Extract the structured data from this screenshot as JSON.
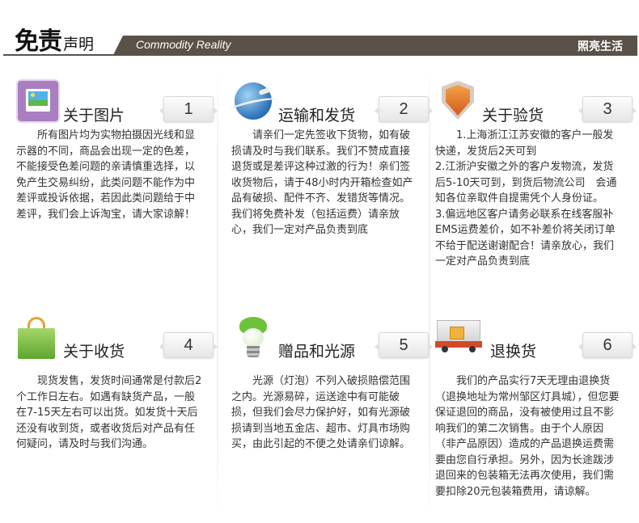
{
  "header": {
    "title_main": "免责",
    "title_sub": "声明",
    "tagline": "Commodity Reality",
    "brand": "照亮生活"
  },
  "cards": [
    {
      "title": "关于图片",
      "number": "1",
      "icon": "picture-icon",
      "lines": [
        "所有图片均为实物拍摄因光线和显示器的不同，商品会出现一定的色差，不能接受色差问题的亲请慎重选择，以免产生交易纠纷，此类问题不能作为中差评或投诉依据，若因此类问题给于中差评，我们会上诉淘宝，请大家谅解！"
      ]
    },
    {
      "title": "运输和发货",
      "number": "2",
      "icon": "globe-shipping-icon",
      "lines": [
        "请亲们一定先签收下货物，如有破损请及时与我们联系。我们不赞成直接退货或是差评这种过激的行为！亲们签收货物后，请于48小时内开箱检查如产品有破损、配件不齐、发错货等情况。我们将免费补发（包括运费）请亲放心，我们一定对产品负责到底"
      ]
    },
    {
      "title": "关于验货",
      "number": "3",
      "icon": "shield-icon",
      "lines": [
        "1.上海浙江江苏安徽的客户一般发快递，发货后2天可到",
        "2.江浙沪安徽之外的客户发物流，发货后5-10天可到，到货后物流公司　会通知各位亲取件自提需凭个人身份证。",
        "3.偏远地区客户请务必联系在线客服补EMS运费差价，如不补差价将关闭订单不给于配送谢谢配合！请亲放心，我们一定对产品负责到底"
      ]
    },
    {
      "title": "关于收货",
      "number": "4",
      "icon": "shopping-bag-icon",
      "lines": [
        "现货发售，发货时间通常是付款后2个工作日左右。如遇有缺货产品，一般在7-15天左右可以出货。如发货十天后还没有收到货，或者收货后对产品有任何疑问，请及时与我们沟通。"
      ]
    },
    {
      "title": "赠品和光源",
      "number": "5",
      "icon": "light-bulb-icon",
      "lines": [
        "光源（灯泡）不列入破损赔偿范围之内。光源易碎，运送途中有可能破损，但我们会尽力保护好，如有光源破损请到当地五金店、超市、灯具市场购买，由此引起的不便之处请亲们谅解。"
      ]
    },
    {
      "title": "退换货",
      "number": "6",
      "icon": "delivery-truck-icon",
      "lines": [
        "我们的产品实行7天无理由退换货（退换地址为常州邹区灯具城），但您要保证退回的商品，没有被使用过且不影响我们的第二次销售。由于个人原因（非产品原因）造成的产品退换运费需要由您自行承担。另外，因为长途跋涉退回来的包装箱无法再次使用，我们需要扣除20元包装箱费用，请谅解。"
      ]
    }
  ]
}
